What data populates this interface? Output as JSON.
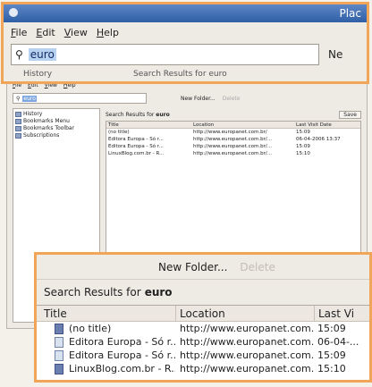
{
  "window": {
    "title": "Plac"
  },
  "menu": [
    "File",
    "Edit",
    "View",
    "Help"
  ],
  "search": {
    "value": "euro"
  },
  "toolbar": {
    "new_folder": "New Folder...",
    "delete": "Delete",
    "new_folder_clipped": "Ne"
  },
  "sidebar": [
    "History",
    "Bookmarks Menu",
    "Bookmarks Toolbar",
    "Subscriptions"
  ],
  "results": {
    "heading": "Search Results for",
    "term": "euro",
    "save": "Save",
    "columns": [
      "Title",
      "Location",
      "Last Visit Date"
    ],
    "rows": [
      {
        "title": "(no title)",
        "location": "http://www.europanet.com.br/",
        "date": "15:09"
      },
      {
        "title": "Editora Europa - Só r...",
        "location": "http://www.europanet.com.br/...",
        "date": "06-04-2006 13:37"
      },
      {
        "title": "Editora Europa - Só r...",
        "location": "http://www.europanet.com.br/...",
        "date": "15:09"
      },
      {
        "title": "LinuxBlog.com.br - R...",
        "location": "http://www.europanet.com.br/...",
        "date": "15:10"
      }
    ]
  },
  "zoom_top": {
    "cut_left": "History",
    "cut_right": "Search Results for euro"
  },
  "zoom_bottom": {
    "columns": [
      "Title",
      "Location",
      "Last Vi"
    ],
    "rows": [
      {
        "title": "(no title)",
        "location": "http://www.europanet.com.br/",
        "date": "15:09"
      },
      {
        "title": "Editora Europa - Só r...",
        "location": "http://www.europanet.com.br/...",
        "date": "06-04-..."
      },
      {
        "title": "Editora Europa - Só r...",
        "location": "http://www.europanet.com.br/...",
        "date": "15:09"
      },
      {
        "title": "LinuxBlog.com.br - R...",
        "location": "http://www.europanet.com.br/...",
        "date": "15:10"
      }
    ]
  }
}
